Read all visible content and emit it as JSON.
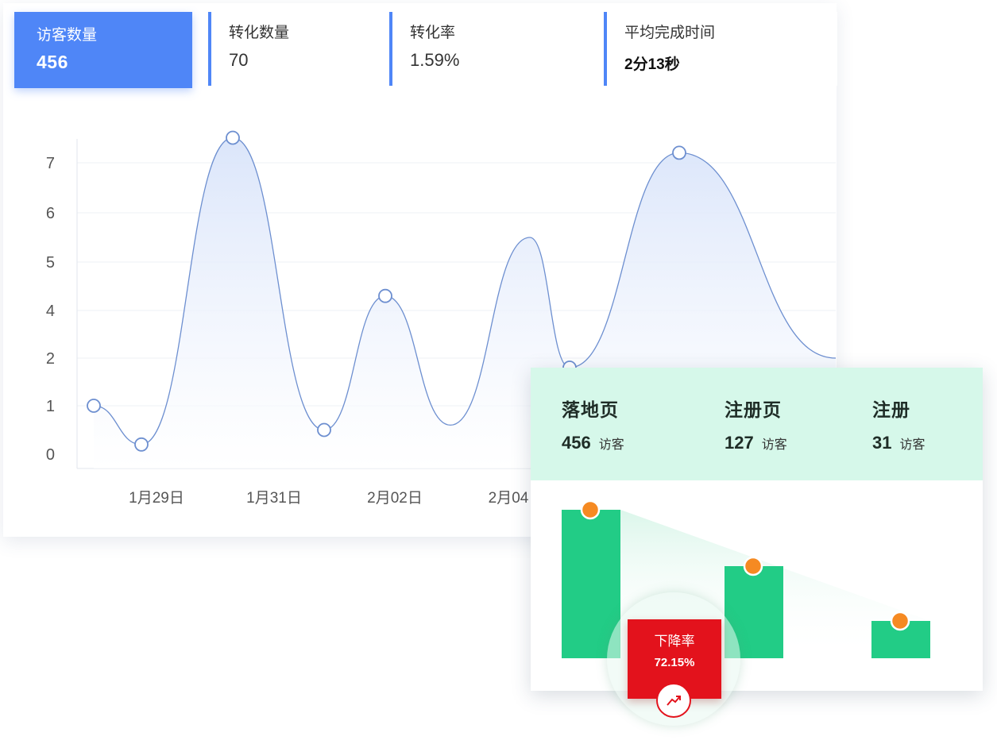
{
  "stats": [
    {
      "label": "访客数量",
      "value": "456",
      "active": true
    },
    {
      "label": "转化数量",
      "value": "70"
    },
    {
      "label": "转化率",
      "value": "1.59%"
    },
    {
      "label": "平均完成时间",
      "value": "2分13秒"
    }
  ],
  "chart_data": {
    "type": "area",
    "x_ticks": [
      "1月29日",
      "1月31日",
      "2月02日",
      "2月04"
    ],
    "y_ticks": [
      "0",
      "1",
      "2",
      "4",
      "5",
      "6",
      "7"
    ],
    "points": [
      1.0,
      0.2,
      7.5,
      0.5,
      4.3,
      1.8,
      7.2
    ],
    "marker_indices": [
      0,
      1,
      2,
      3,
      4,
      5,
      6
    ],
    "grid": true,
    "colors": {
      "line": "#6d8fd0",
      "fill": "#dfe8fb",
      "marker_fill": "#ffffff"
    }
  },
  "funnel": {
    "stages": [
      {
        "name": "落地页",
        "count": "456",
        "unit": "访客",
        "value": 456
      },
      {
        "name": "注册页",
        "count": "127",
        "unit": "访客",
        "value": 127
      },
      {
        "name": "注册",
        "count": "31",
        "unit": "访客",
        "value": 31
      }
    ],
    "drop": {
      "label": "下降率",
      "value": "72.15%"
    },
    "colors": {
      "bar": "#22cc86",
      "dot": "#f58a22",
      "drop_box": "#e3121c",
      "header_bg": "#d6f8ea"
    }
  }
}
